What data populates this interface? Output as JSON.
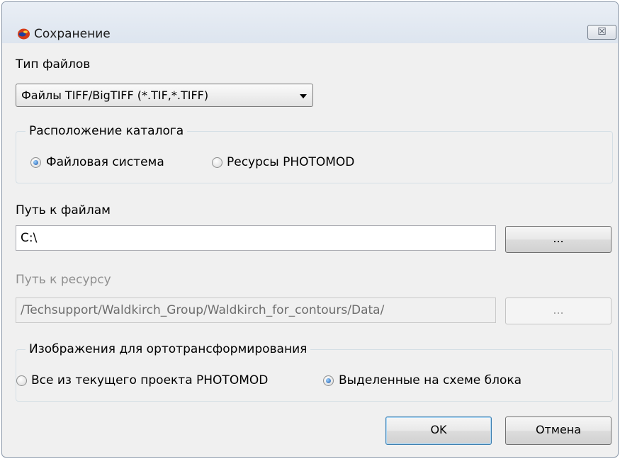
{
  "dialog": {
    "title": "Сохранение",
    "close_glyph": "☒"
  },
  "file_type": {
    "label": "Тип файлов",
    "selected": "Файлы TIFF/BigTIFF (*.TIF,*.TIFF)"
  },
  "catalog_location": {
    "caption": "Расположение каталога",
    "options": [
      {
        "label": "Файловая система",
        "checked": true
      },
      {
        "label": "Ресурсы PHOTOMOD",
        "checked": false
      }
    ]
  },
  "file_path": {
    "label": "Путь к файлам",
    "value": "C:\\",
    "browse_label": "..."
  },
  "resource_path": {
    "label": "Путь к ресурсу",
    "value": "/Techsupport/Waldkirch_Group/Waldkirch_for_contours/Data/",
    "browse_label": "..."
  },
  "ortho_images": {
    "caption": "Изображения для ортотрансформирования",
    "options": [
      {
        "label": "Все из текущего проекта PHOTOMOD",
        "checked": false
      },
      {
        "label": "Выделенные на схеме блока",
        "checked": true
      }
    ]
  },
  "buttons": {
    "ok": "OK",
    "cancel": "Отмена"
  },
  "icons": {
    "app": "photomod-app-icon",
    "dropdown": "chevron-down-icon",
    "close": "close-icon"
  }
}
